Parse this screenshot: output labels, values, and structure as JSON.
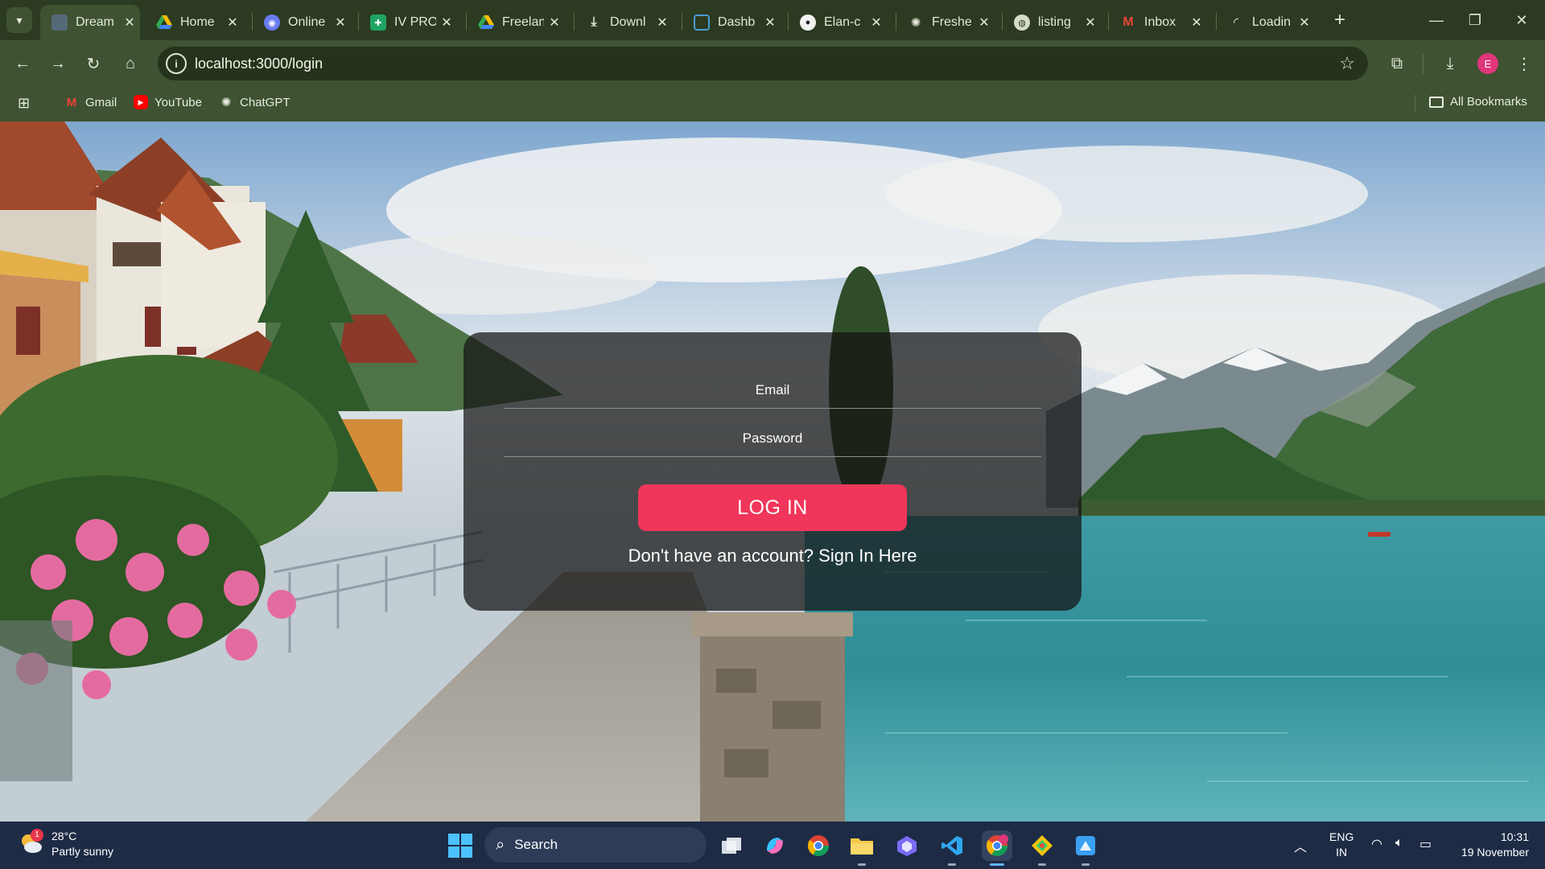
{
  "browser": {
    "tabs": [
      {
        "label": "Dream",
        "active": true
      },
      {
        "label": "Home"
      },
      {
        "label": "Online"
      },
      {
        "label": "IV PRO"
      },
      {
        "label": "Freelan"
      },
      {
        "label": "Downl"
      },
      {
        "label": "Dashb"
      },
      {
        "label": "Elan-c"
      },
      {
        "label": "Freshe"
      },
      {
        "label": "listing"
      },
      {
        "label": "Inbox"
      },
      {
        "label": "Loadin"
      }
    ],
    "new_tab": "+",
    "url": "localhost:3000/login",
    "profile_initial": "E",
    "bookmarks": [
      {
        "label": "Gmail"
      },
      {
        "label": "YouTube"
      },
      {
        "label": "ChatGPT"
      }
    ],
    "all_bookmarks": "All Bookmarks"
  },
  "login": {
    "email_label": "Email",
    "password_label": "Password",
    "button_label": "LOG IN",
    "signup_prompt": "Don't have an account? Sign In Here"
  },
  "taskbar": {
    "weather_temp": "28°C",
    "weather_desc": "Partly sunny",
    "weather_badge": "1",
    "search_label": "Search",
    "lang_primary": "ENG",
    "lang_secondary": "IN",
    "time": "10:31",
    "date": "19 November"
  },
  "colors": {
    "chrome_dark": "#2b3a20",
    "chrome": "#3f5232",
    "login_accent": "#f0365a",
    "taskbar": "#1e2b45"
  }
}
